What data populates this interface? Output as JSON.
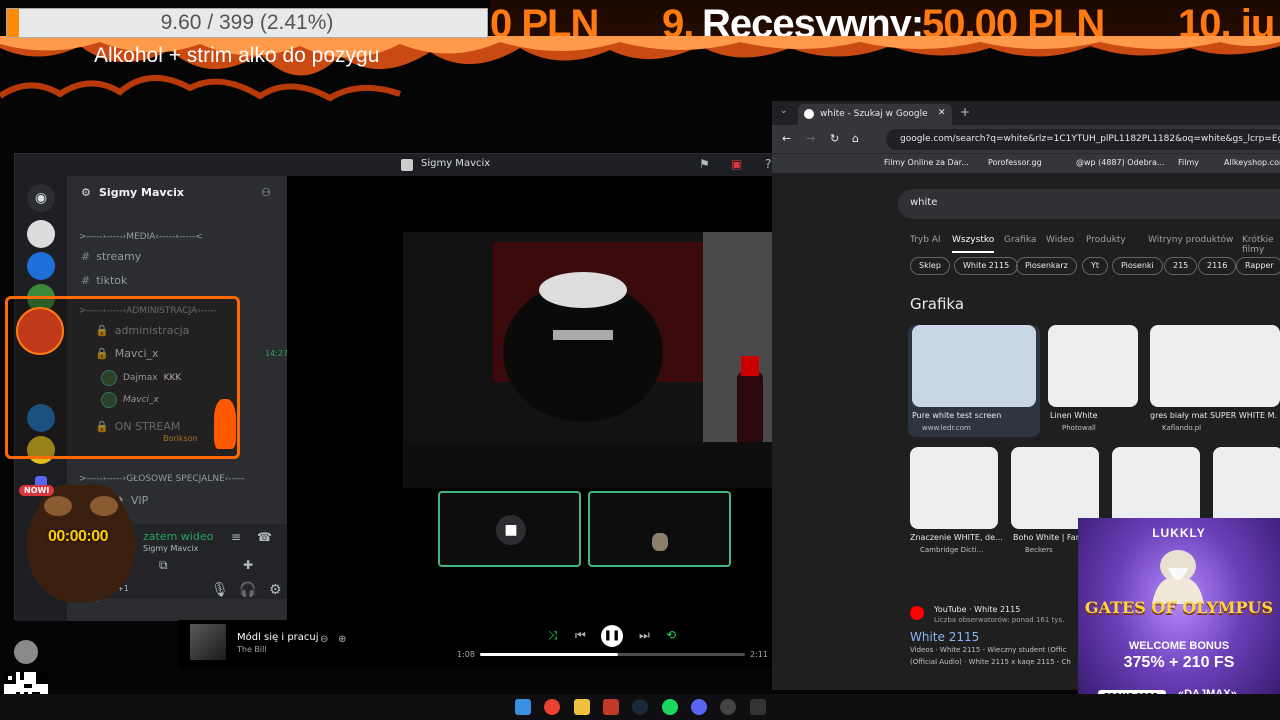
{
  "overlay": {
    "goal_text": "9.60 / 399 (2.41%)",
    "goal_fraction": 0.0241,
    "goal_title": "Alkohol + strim alko do pozygu",
    "ticker": {
      "prev_amount": "0 PLN",
      "entry9": "9. Recesywny: 50.00 PLN",
      "entry9_rank": "9.",
      "entry9_name": "Recesywny:",
      "entry9_amount": "50.00 PLN",
      "entry10": "10. ju"
    },
    "timer": "00:00:00",
    "nowy_badge": "NOWI"
  },
  "discord": {
    "window_title": "Sigmy Mavcix",
    "server_name": "Sigmy Mavcix",
    "categories": [
      ">-----›-----›MEDIA‹-----‹-----<",
      ">-----›-----›ADMINISTRACJA‹-----",
      ">-----›-----›GŁOSOWE SPECJALNE‹-----"
    ],
    "channels": [
      {
        "label": "streamy"
      },
      {
        "label": "tiktok"
      },
      {
        "label": "administracja"
      },
      {
        "label": "Mavci_x",
        "time": "14:27"
      },
      {
        "label": "ON STREAM"
      },
      {
        "label": "VIP"
      }
    ],
    "members": [
      {
        "name": "Dajmax",
        "badge": "KKK"
      },
      {
        "name": "Mavci_x"
      }
    ],
    "streamer_label": "Borikson",
    "voice_status": "zatem wideo",
    "voice_sub": "Sigmy Mavcix",
    "user_sub": "+1"
  },
  "spotify": {
    "title": "Módl się i pracuj",
    "artist": "The Bill",
    "current": "1:08",
    "duration": "2:11",
    "progress": 0.52
  },
  "chrome": {
    "tab_title": "white - Szukaj w Google",
    "url": "google.com/search?q=white&rlz=1C1YTUH_plPL1182PL1182&oq=white&gs_lcrp=EgZjaHJvbW",
    "bookmarks": [
      "Filmy Online za Dar...",
      "Porofessor.gg",
      "@wp (4887) Odebra...",
      "Filmy",
      "Allkeyshop.com"
    ],
    "search_query": "white",
    "nav_tabs": [
      "Tryb AI",
      "Wszystko",
      "Grafika",
      "Wideo",
      "Produkty",
      "Witryny produktów",
      "Krótkie filmy"
    ],
    "chips": [
      "Sklep",
      "White 2115",
      "Piosenkarz",
      "Yt",
      "Piosenki",
      "215",
      "2116",
      "Rapper"
    ],
    "section_title": "Grafika",
    "images_row1": [
      {
        "caption": "Pure white test screen",
        "source": "www.ledr.com"
      },
      {
        "caption": "Linen White",
        "source": "Photowall"
      },
      {
        "caption": "gres biały mat SUPER WHITE M...",
        "source": "Kaflando.pl"
      }
    ],
    "images_row2": [
      {
        "caption": "Znaczenie WHITE, de...",
        "source": "Cambridge Dicti..."
      },
      {
        "caption": "Boho White | Farb...",
        "source": "Beckers"
      },
      {
        "caption": "",
        "source": ""
      },
      {
        "caption": "",
        "source": ""
      }
    ],
    "youtube": {
      "source": "YouTube · White 2115",
      "sub": "Liczba obserwatorów: ponad 161 tys.",
      "title": "White 2115",
      "desc1": "Videos · White 2115 - Wieczny student (Offic",
      "desc2": "(Official Audio) · White 2115 x kaqe 2115 - Ch"
    }
  },
  "ad": {
    "brand": "LUKKLY",
    "game": "GATES OF OLYMPUS",
    "welcome": "WELCOME BONUS",
    "bonus": "375% + 210 FS",
    "promo_label": "PROMO CODE:",
    "promo_code": "«DAJMAX»"
  },
  "colors": {
    "accent_orange": "#ff7a10",
    "discord_green": "#43b581",
    "chrome_bg": "#1f1f1f"
  },
  "icons": [
    "discord-icon",
    "gear-icon",
    "add-user-icon",
    "hash-icon",
    "lock-icon",
    "mic-icon",
    "headphones-icon",
    "settings-icon",
    "camera-icon",
    "shuffle-icon",
    "prev-icon",
    "pause-icon",
    "next-icon",
    "repeat-icon",
    "back-icon",
    "forward-icon",
    "reload-icon",
    "home-icon",
    "close-icon",
    "windows-start-icon",
    "chrome-icon",
    "folder-icon",
    "steam-icon",
    "spotify-icon"
  ]
}
